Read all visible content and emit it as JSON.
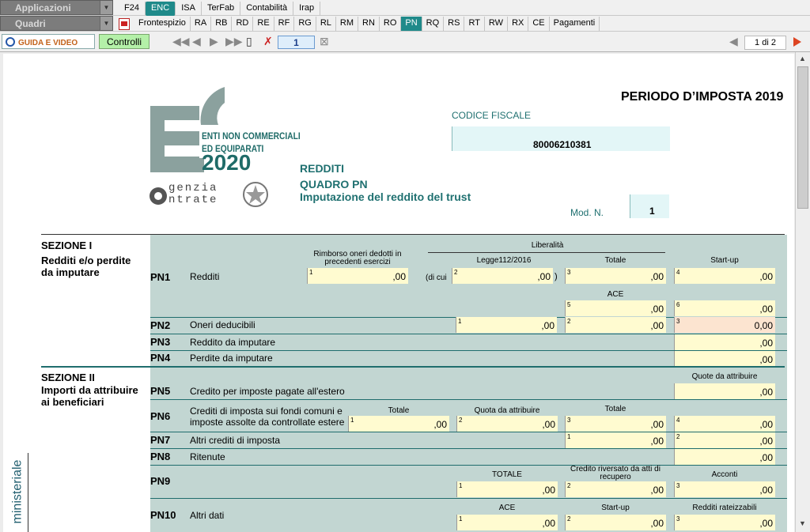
{
  "toolbar1": {
    "combo": "Applicazioni",
    "tabs": [
      "F24",
      "ENC",
      "ISA",
      "TerFab",
      "Contabilità",
      "Irap"
    ],
    "active": "ENC"
  },
  "toolbar2": {
    "combo": "Quadri",
    "tabs": [
      "Frontespizio",
      "RA",
      "RB",
      "RD",
      "RE",
      "RF",
      "RG",
      "RL",
      "RM",
      "RN",
      "RO",
      "PN",
      "RQ",
      "RS",
      "RT",
      "RW",
      "RX",
      "CE",
      "Pagamenti"
    ],
    "active": "PN"
  },
  "toolbar3": {
    "guida": "GUIDA E VIDEO",
    "controlli": "Controlli",
    "page_input": "1",
    "page_of": "1 di 2"
  },
  "header": {
    "periodo": "PERIODO D’IMPOSTA 2019",
    "cf_label": "CODICE FISCALE",
    "cf_value": "80006210381",
    "logo_line1": "ENTI NON COMMERCIALI",
    "logo_line2": "ED EQUIPARATI",
    "logo_year": "2020",
    "agenzia1": "genzia",
    "agenzia2": "ntrate",
    "redditi": "REDDITI",
    "quadro": "QUADRO PN",
    "imputazione": "Imputazione del reddito del trust",
    "mod_label": "Mod. N.",
    "mod_value": "1"
  },
  "sez1": {
    "title": "SEZIONE I",
    "sub": "Redditi e/o perdite da imputare"
  },
  "sez2": {
    "title": "SEZIONE II",
    "sub": "Importi da attribuire ai beneficiari"
  },
  "cols": {
    "rimborso": "Rimborso oneri dedotti in precedenti esercizi",
    "liberalita": "Liberalità",
    "legge": "Legge112/2016",
    "totale": "Totale",
    "startup": "Start-up",
    "ace": "ACE",
    "dicui": "(di cui",
    "paren": ")",
    "quote_attribuire": "Quote da attribuire",
    "quota_attribuire": "Quota da attribuire",
    "totale_caps": "TOTALE",
    "credito_riversato": "Credito riversato da atti di recupero",
    "acconti": "Acconti",
    "redditi_rateizzabili": "Redditi rateizzabili"
  },
  "rows": {
    "PN1": {
      "code": "PN1",
      "label": "Redditi"
    },
    "PN2": {
      "code": "PN2",
      "label": "Oneri deducibili"
    },
    "PN3": {
      "code": "PN3",
      "label": "Reddito da imputare"
    },
    "PN4": {
      "code": "PN4",
      "label": "Perdite da imputare"
    },
    "PN5": {
      "code": "PN5",
      "label": "Credito per imposte pagate all'estero"
    },
    "PN6": {
      "code": "PN6",
      "label": "Crediti di imposta sui fondi comuni e imposte assolte da controllate estere"
    },
    "PN7": {
      "code": "PN7",
      "label": "Altri crediti di imposta"
    },
    "PN8": {
      "code": "PN8",
      "label": "Ritenute"
    },
    "PN9": {
      "code": "PN9",
      "label": ""
    },
    "PN10": {
      "code": "PN10",
      "label": "Altri dati"
    }
  },
  "values": {
    "zero": ",00",
    "pn2_3": "0,00"
  },
  "side": {
    "ministeriale": "ministeriale"
  },
  "colors": {
    "accent": "#1f8a8a",
    "field": "#fffbd0",
    "grid": "#c2d6d2",
    "highlight": "#fce4d0"
  }
}
